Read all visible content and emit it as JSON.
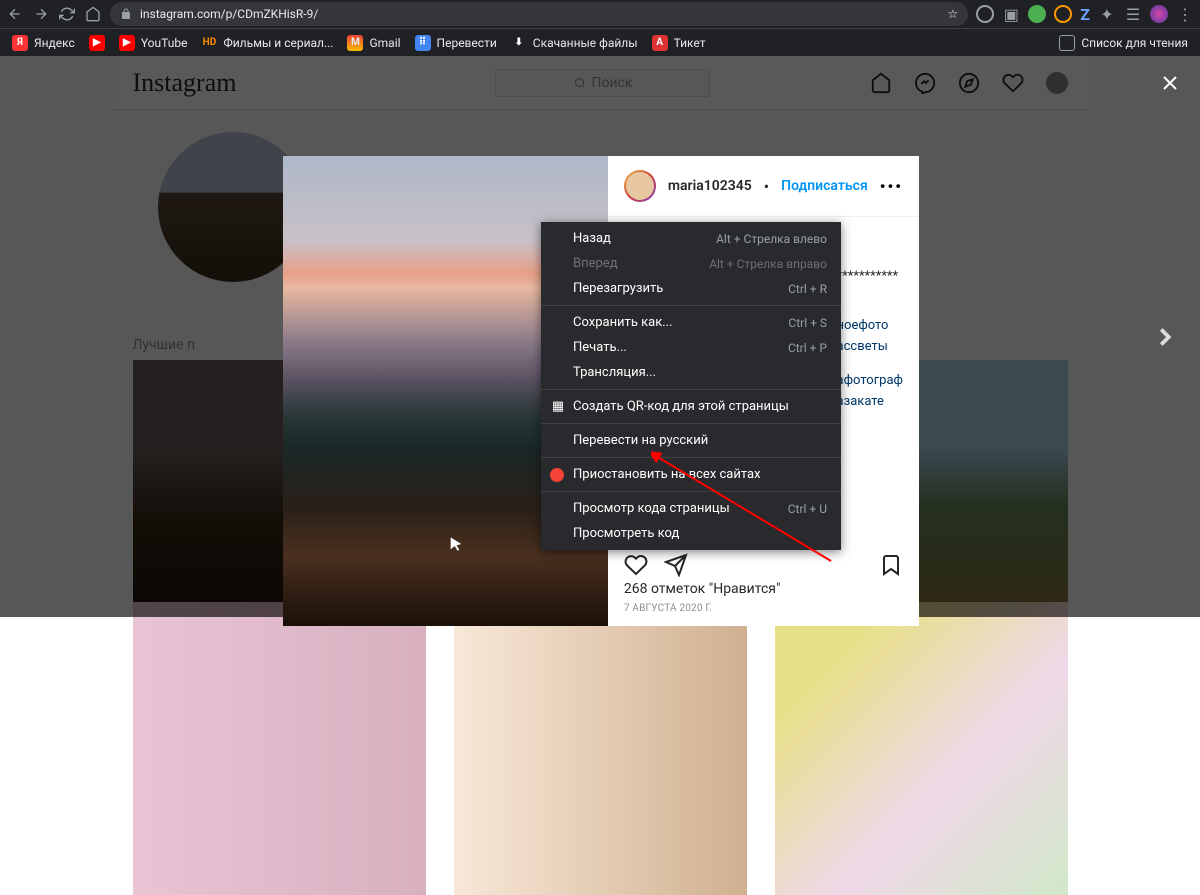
{
  "browser": {
    "url": "instagram.com/p/CDmZKHisR-9/",
    "bookmarks": [
      "Яндекс",
      "",
      "YouTube",
      "",
      "Фильмы и сериал...",
      "",
      "Gmail",
      "",
      "Перевести",
      "",
      "Скачанные файлы",
      "",
      "Тикет"
    ],
    "bm": {
      "yandex": "Яндекс",
      "youtube": "YouTube",
      "films": "Фильмы и сериал...",
      "gmail": "Gmail",
      "translate": "Перевести",
      "downloads": "Скачанные файлы",
      "ticket": "Тикет",
      "readlist": "Список для чтения"
    }
  },
  "instagram": {
    "search_placeholder": "Поиск",
    "side_label": "Лучшие п",
    "modal": {
      "username": "maria102345",
      "subscribe": "Подписаться",
      "stars_line": "***********",
      "tag1": "ноефото",
      "tag2": "ассветы",
      "tag3": "афотограф",
      "tag4": "азакате",
      "likes": "268 отметок \"Нравится\"",
      "date": "7 АВГУСТА 2020 Г."
    }
  },
  "context_menu": {
    "back": "Назад",
    "back_sc": "Alt + Стрелка влево",
    "forward": "Вперед",
    "forward_sc": "Alt + Стрелка вправо",
    "reload": "Перезагрузить",
    "reload_sc": "Ctrl + R",
    "save_as": "Сохранить как...",
    "save_sc": "Ctrl + S",
    "print": "Печать...",
    "print_sc": "Ctrl + P",
    "cast": "Трансляция...",
    "qr": "Создать QR-код для этой страницы",
    "translate": "Перевести на русский",
    "pause": "Приостановить на всех сайтах",
    "view_source": "Просмотр кода страницы",
    "view_source_sc": "Ctrl + U",
    "inspect": "Просмотреть код"
  }
}
